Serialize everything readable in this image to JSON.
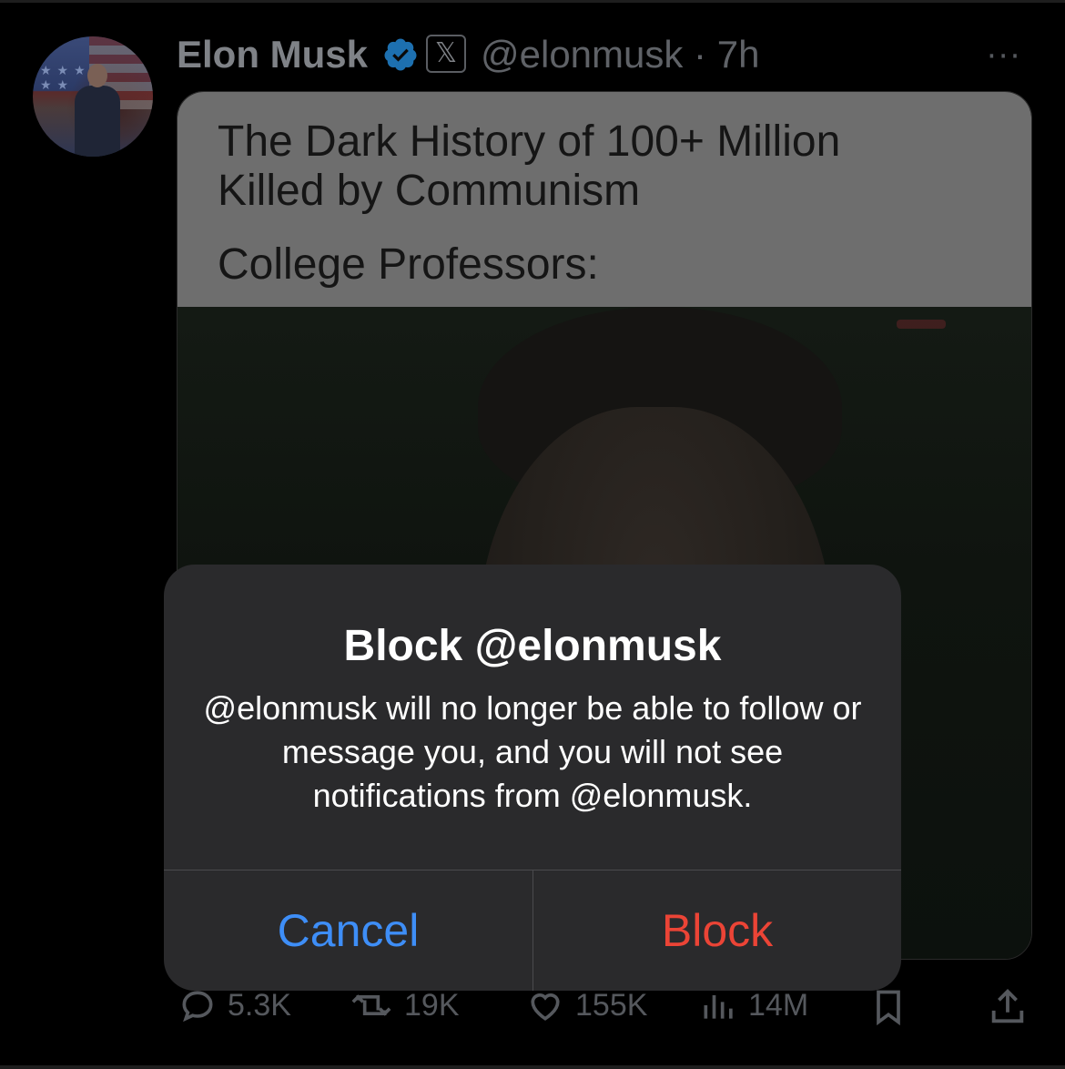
{
  "tweet": {
    "author_name": "Elon Musk",
    "x_badge": "𝕏",
    "handle_time": "@elonmusk · 7h",
    "more_label": "···",
    "caption_line1": "The Dark History of 100+ Million Killed by Communism",
    "caption_line2": "College Professors:"
  },
  "actions": {
    "replies": "5.3K",
    "reposts": "19K",
    "likes": "155K",
    "views": "14M"
  },
  "alert": {
    "title": "Block @elonmusk",
    "message": "@elonmusk will no longer be able to follow or message you, and you will not see notifications from @elonmusk.",
    "cancel_label": "Cancel",
    "block_label": "Block"
  },
  "colors": {
    "verified": "#1d9bf0",
    "cancel": "#3e8ef7",
    "block": "#eb4436",
    "alert_bg": "#2a2a2c"
  }
}
